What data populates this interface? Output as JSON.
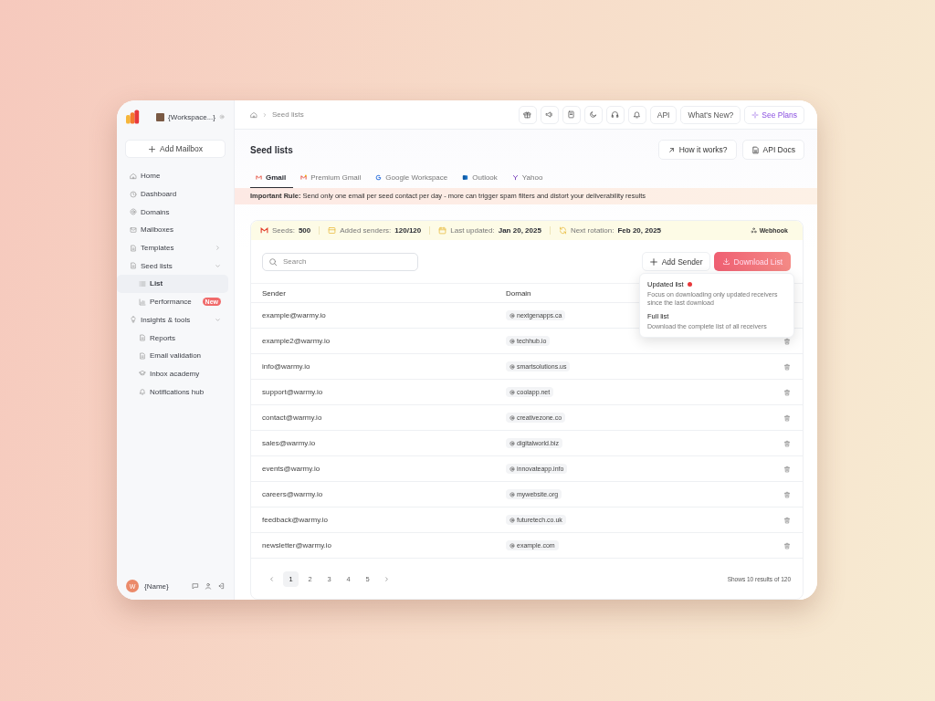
{
  "workspace": {
    "name": "{Workspace...}"
  },
  "add_mailbox": "Add Mailbox",
  "sidebar": {
    "items": [
      {
        "label": "Home",
        "selected": false
      },
      {
        "label": "Dashboard",
        "selected": false
      },
      {
        "label": "Domains",
        "selected": false
      },
      {
        "label": "Mailboxes",
        "selected": false
      },
      {
        "label": "Templates",
        "selected": false,
        "expanded": false
      },
      {
        "label": "Seed lists",
        "selected": false,
        "expanded": true,
        "children": [
          {
            "label": "List",
            "selected": true
          },
          {
            "label": "Performance",
            "selected": false,
            "badge": "New"
          }
        ]
      },
      {
        "label": "Insights & tools",
        "selected": false,
        "expanded": true,
        "children": [
          {
            "label": "Reports",
            "selected": false
          },
          {
            "label": "Email validation",
            "selected": false
          },
          {
            "label": "Inbox  academy",
            "selected": false
          },
          {
            "label": "Notifications hub",
            "selected": false
          }
        ]
      }
    ]
  },
  "user": {
    "initial": "W",
    "name": "{Name}"
  },
  "breadcrumb": [
    "Seed lists"
  ],
  "top_buttons": [
    {
      "label": "API",
      "kind": "plain"
    },
    {
      "label": "What's New?",
      "kind": "plain"
    },
    {
      "label": "See Plans",
      "kind": "plans"
    }
  ],
  "page_title": "Seed lists",
  "header_buttons": [
    "How it works?",
    "API Docs"
  ],
  "tabs": [
    {
      "label": "Gmail",
      "selected": true
    },
    {
      "label": "Premium Gmail",
      "selected": false
    },
    {
      "label": "Google Workspace",
      "selected": false
    },
    {
      "label": "Outlook",
      "selected": false
    },
    {
      "label": "Yahoo",
      "selected": false
    }
  ],
  "notice": "**Important Rule:** Send only one email per seed contact per day - more can trigger spam filters and distort your deliverability results",
  "stats": [
    {
      "label": "Seeds:",
      "value": "500"
    },
    {
      "label": "Added senders:",
      "value": "120/120"
    },
    {
      "label": "Last updated:",
      "value": "Jan 20, 2025"
    },
    {
      "label": "Next rotation:",
      "value": "Feb 20, 2025"
    }
  ],
  "webhook": "Webhook",
  "search": {
    "placeholder": "Search"
  },
  "add_sender": "Add Sender",
  "download": "Download List",
  "download_menu": {
    "items": [
      {
        "title": "Updated list",
        "description": "Focus on downloading only updated receivers since the last download",
        "new": true
      },
      {
        "title": "Full list",
        "description": "Download the complete list of all receivers",
        "new": false
      }
    ]
  },
  "table": {
    "columns": [
      "Sender",
      "Domain"
    ],
    "rows": [
      {
        "sender": "example@warmy.io",
        "domain": "nextgenapps.ca"
      },
      {
        "sender": "example2@warmy.io",
        "domain": "techhub.io"
      },
      {
        "sender": "info@warmy.io",
        "domain": "smartsolutions.us"
      },
      {
        "sender": "support@warmy.io",
        "domain": "coolapp.net"
      },
      {
        "sender": "contact@warmy.io",
        "domain": "creativezone.co"
      },
      {
        "sender": "sales@warmy.io",
        "domain": "digitalworld.biz"
      },
      {
        "sender": "events@warmy.io",
        "domain": "innovateapp.info"
      },
      {
        "sender": "careers@warmy.io",
        "domain": "mywebsite.org"
      },
      {
        "sender": "feedback@warmy.io",
        "domain": "futuretech.co.uk"
      },
      {
        "sender": "newsletter@warmy.io",
        "domain": "example.com"
      }
    ]
  },
  "pagination": {
    "pages": [
      {
        "label": "1",
        "selected": true
      },
      {
        "label": "2",
        "selected": false
      },
      {
        "label": "3",
        "selected": false
      },
      {
        "label": "4",
        "selected": false
      },
      {
        "label": "5",
        "selected": false
      }
    ],
    "summary": "Shows 10 results of 120"
  }
}
